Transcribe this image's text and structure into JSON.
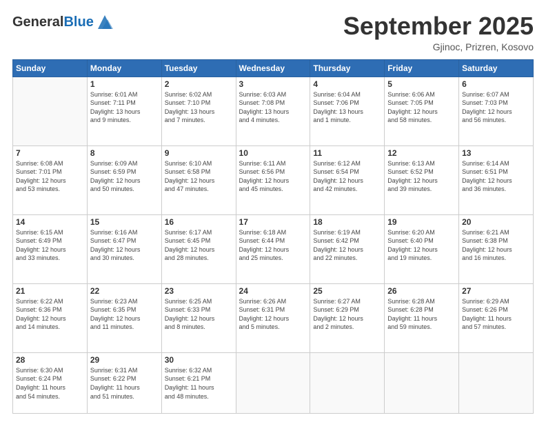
{
  "logo": {
    "general": "General",
    "blue": "Blue"
  },
  "header": {
    "month_year": "September 2025",
    "location": "Gjinoc, Prizren, Kosovo"
  },
  "days_of_week": [
    "Sunday",
    "Monday",
    "Tuesday",
    "Wednesday",
    "Thursday",
    "Friday",
    "Saturday"
  ],
  "weeks": [
    [
      {
        "day": "",
        "info": ""
      },
      {
        "day": "1",
        "info": "Sunrise: 6:01 AM\nSunset: 7:11 PM\nDaylight: 13 hours\nand 9 minutes."
      },
      {
        "day": "2",
        "info": "Sunrise: 6:02 AM\nSunset: 7:10 PM\nDaylight: 13 hours\nand 7 minutes."
      },
      {
        "day": "3",
        "info": "Sunrise: 6:03 AM\nSunset: 7:08 PM\nDaylight: 13 hours\nand 4 minutes."
      },
      {
        "day": "4",
        "info": "Sunrise: 6:04 AM\nSunset: 7:06 PM\nDaylight: 13 hours\nand 1 minute."
      },
      {
        "day": "5",
        "info": "Sunrise: 6:06 AM\nSunset: 7:05 PM\nDaylight: 12 hours\nand 58 minutes."
      },
      {
        "day": "6",
        "info": "Sunrise: 6:07 AM\nSunset: 7:03 PM\nDaylight: 12 hours\nand 56 minutes."
      }
    ],
    [
      {
        "day": "7",
        "info": "Sunrise: 6:08 AM\nSunset: 7:01 PM\nDaylight: 12 hours\nand 53 minutes."
      },
      {
        "day": "8",
        "info": "Sunrise: 6:09 AM\nSunset: 6:59 PM\nDaylight: 12 hours\nand 50 minutes."
      },
      {
        "day": "9",
        "info": "Sunrise: 6:10 AM\nSunset: 6:58 PM\nDaylight: 12 hours\nand 47 minutes."
      },
      {
        "day": "10",
        "info": "Sunrise: 6:11 AM\nSunset: 6:56 PM\nDaylight: 12 hours\nand 45 minutes."
      },
      {
        "day": "11",
        "info": "Sunrise: 6:12 AM\nSunset: 6:54 PM\nDaylight: 12 hours\nand 42 minutes."
      },
      {
        "day": "12",
        "info": "Sunrise: 6:13 AM\nSunset: 6:52 PM\nDaylight: 12 hours\nand 39 minutes."
      },
      {
        "day": "13",
        "info": "Sunrise: 6:14 AM\nSunset: 6:51 PM\nDaylight: 12 hours\nand 36 minutes."
      }
    ],
    [
      {
        "day": "14",
        "info": "Sunrise: 6:15 AM\nSunset: 6:49 PM\nDaylight: 12 hours\nand 33 minutes."
      },
      {
        "day": "15",
        "info": "Sunrise: 6:16 AM\nSunset: 6:47 PM\nDaylight: 12 hours\nand 30 minutes."
      },
      {
        "day": "16",
        "info": "Sunrise: 6:17 AM\nSunset: 6:45 PM\nDaylight: 12 hours\nand 28 minutes."
      },
      {
        "day": "17",
        "info": "Sunrise: 6:18 AM\nSunset: 6:44 PM\nDaylight: 12 hours\nand 25 minutes."
      },
      {
        "day": "18",
        "info": "Sunrise: 6:19 AM\nSunset: 6:42 PM\nDaylight: 12 hours\nand 22 minutes."
      },
      {
        "day": "19",
        "info": "Sunrise: 6:20 AM\nSunset: 6:40 PM\nDaylight: 12 hours\nand 19 minutes."
      },
      {
        "day": "20",
        "info": "Sunrise: 6:21 AM\nSunset: 6:38 PM\nDaylight: 12 hours\nand 16 minutes."
      }
    ],
    [
      {
        "day": "21",
        "info": "Sunrise: 6:22 AM\nSunset: 6:36 PM\nDaylight: 12 hours\nand 14 minutes."
      },
      {
        "day": "22",
        "info": "Sunrise: 6:23 AM\nSunset: 6:35 PM\nDaylight: 12 hours\nand 11 minutes."
      },
      {
        "day": "23",
        "info": "Sunrise: 6:25 AM\nSunset: 6:33 PM\nDaylight: 12 hours\nand 8 minutes."
      },
      {
        "day": "24",
        "info": "Sunrise: 6:26 AM\nSunset: 6:31 PM\nDaylight: 12 hours\nand 5 minutes."
      },
      {
        "day": "25",
        "info": "Sunrise: 6:27 AM\nSunset: 6:29 PM\nDaylight: 12 hours\nand 2 minutes."
      },
      {
        "day": "26",
        "info": "Sunrise: 6:28 AM\nSunset: 6:28 PM\nDaylight: 11 hours\nand 59 minutes."
      },
      {
        "day": "27",
        "info": "Sunrise: 6:29 AM\nSunset: 6:26 PM\nDaylight: 11 hours\nand 57 minutes."
      }
    ],
    [
      {
        "day": "28",
        "info": "Sunrise: 6:30 AM\nSunset: 6:24 PM\nDaylight: 11 hours\nand 54 minutes."
      },
      {
        "day": "29",
        "info": "Sunrise: 6:31 AM\nSunset: 6:22 PM\nDaylight: 11 hours\nand 51 minutes."
      },
      {
        "day": "30",
        "info": "Sunrise: 6:32 AM\nSunset: 6:21 PM\nDaylight: 11 hours\nand 48 minutes."
      },
      {
        "day": "",
        "info": ""
      },
      {
        "day": "",
        "info": ""
      },
      {
        "day": "",
        "info": ""
      },
      {
        "day": "",
        "info": ""
      }
    ]
  ]
}
